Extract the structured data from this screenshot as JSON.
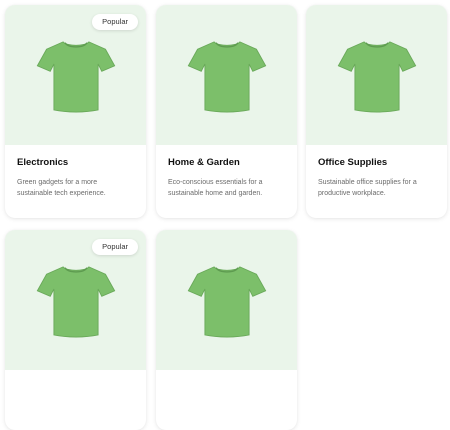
{
  "colors": {
    "image_background": "#eaf5ea",
    "shirt_fill": "#7cbf6a"
  },
  "products": [
    {
      "badge": "Popular",
      "title": "Electronics",
      "description": "Green gadgets for a more sustainable tech experience.",
      "image_icon": "tshirt-icon"
    },
    {
      "badge": "",
      "title": "Home & Garden",
      "description": "Eco-conscious essentials for a sustainable home and garden.",
      "image_icon": "tshirt-icon"
    },
    {
      "badge": "",
      "title": "Office Supplies",
      "description": "Sustainable office supplies for a productive workplace.",
      "image_icon": "tshirt-icon"
    },
    {
      "badge": "Popular",
      "title": "",
      "description": "",
      "image_icon": "tshirt-icon"
    },
    {
      "badge": "",
      "title": "",
      "description": "",
      "image_icon": "tshirt-icon"
    }
  ]
}
